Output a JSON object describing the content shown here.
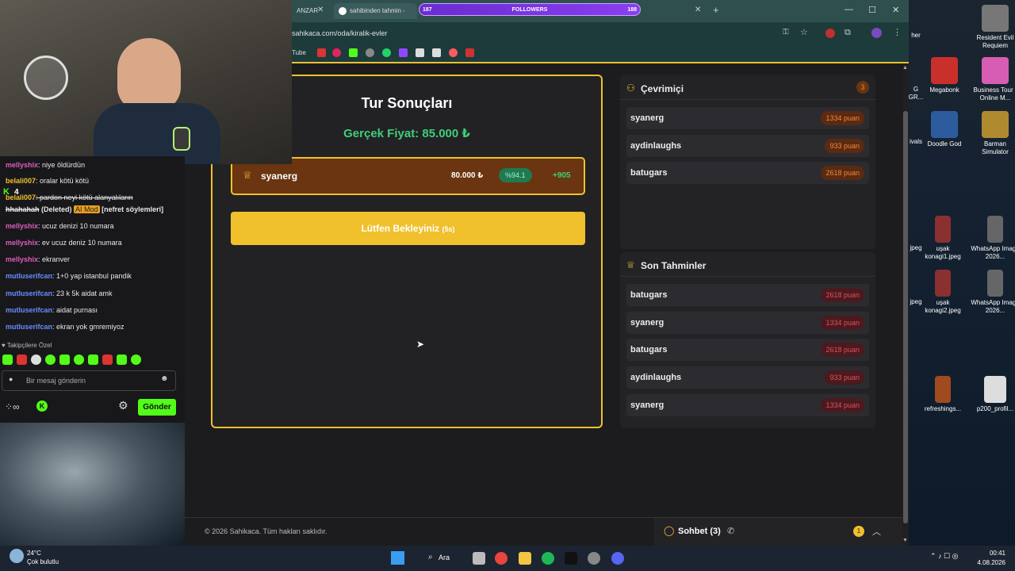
{
  "browser": {
    "tabs": [
      {
        "label": "ANZAR"
      },
      {
        "label": "sahibinden tahmin - Goo"
      }
    ],
    "url": "sahikaca.com/oda/kiralik-evler",
    "bookmark_youtube": "Tube",
    "followers_overlay": {
      "left": "187",
      "label": "FOLLOWERS",
      "right": "188"
    }
  },
  "results": {
    "title": "Tur Sonuçları",
    "real_price": "Gerçek Fiyat: 85.000 ₺",
    "winner": {
      "name": "syanerg",
      "guess": "80.000 ₺",
      "accuracy": "%94.1",
      "points": "+905"
    },
    "wait_button": "Lütfen Bekleyiniz",
    "wait_seconds": "(5s)"
  },
  "online": {
    "title": "Çevrimiçi",
    "count": "3",
    "users": [
      {
        "name": "syanerg",
        "points": "1334 puan"
      },
      {
        "name": "aydinlaughs",
        "points": "933 puan"
      },
      {
        "name": "batugars",
        "points": "2618 puan"
      }
    ]
  },
  "recent": {
    "title": "Son Tahminler",
    "items": [
      {
        "name": "batugars",
        "points": "2618 puan"
      },
      {
        "name": "syanerg",
        "points": "1334 puan"
      },
      {
        "name": "batugars",
        "points": "2618 puan"
      },
      {
        "name": "aydinlaughs",
        "points": "933 puan"
      },
      {
        "name": "syanerg",
        "points": "1334 puan"
      }
    ]
  },
  "footer": {
    "copyright": "© 2026 Sahikaca. Tüm hakları saklıdır.",
    "chat_label": "Sohbet (3)",
    "badge": "1"
  },
  "chat": {
    "lines": [
      {
        "user": "mellyshix",
        "text": ": niye öldürdün"
      },
      {
        "user": "belali007",
        "text": ": oralar kötü kötü"
      },
      {
        "user": "belali007",
        "text": ": pardon neyi kötü alanyalıların"
      },
      {
        "user": "hhahahah",
        "text": " (Deleted)",
        "mod": "AI Mod",
        "reason": "[nefret söylemleri]"
      },
      {
        "user": "mellyshix",
        "text": ": ucuz denizi 10 numara"
      },
      {
        "user": "mellyshix",
        "text": ": ev ucuz deniz 10 numara"
      },
      {
        "user": "mellyshix",
        "text": ": ekranver"
      },
      {
        "user": "mutluserifcan",
        "text": ": 1+0 yap istanbul pandik"
      },
      {
        "user": "mutluserifcan",
        "text": ": 23 k 5k aidat amk"
      },
      {
        "user": "mutluserifcan",
        "text": ": aidat purnası"
      },
      {
        "user": "mutluserifcan",
        "text": ": ekran yok gmremiyoz"
      }
    ],
    "viewer_count": "4",
    "followers_only": "Takipçilere Özel",
    "input_placeholder": "Bir mesaj gönderin",
    "send_button": "Gönder"
  },
  "desktop": {
    "icons": [
      {
        "label": "Resident Evil Requiem"
      },
      {
        "label": "Megabonk"
      },
      {
        "label": "Business Tour - Online M..."
      },
      {
        "label": "Doodle God"
      },
      {
        "label": "Barman Simulator"
      },
      {
        "label": "uşak konagi1.jpeg"
      },
      {
        "label": "WhatsApp Image 2026..."
      },
      {
        "label": "uşak konagi2.jpeg"
      },
      {
        "label": "WhatsApp Image 2026..."
      },
      {
        "label": "refreshings..."
      },
      {
        "label": "p200_profil..."
      }
    ],
    "partial_labels": [
      "her",
      "G",
      "GR...",
      "ivals",
      "jpeg",
      "jpeg"
    ]
  },
  "taskbar": {
    "weather_temp": "24°C",
    "weather_desc": "Çok bulutlu",
    "search_label": "Ara",
    "time": "00:41",
    "date": "4.08.2026"
  }
}
